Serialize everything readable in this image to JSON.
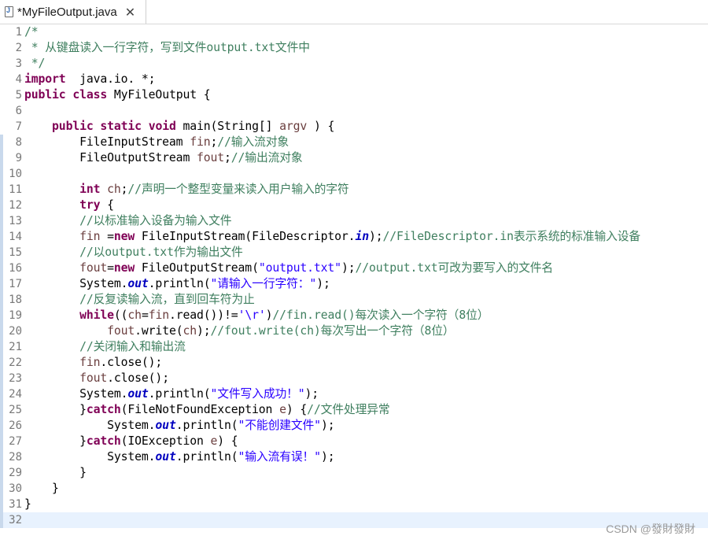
{
  "tab": {
    "title": "*MyFileOutput.java",
    "icon": "java-file-icon",
    "close": "✕"
  },
  "watermark": "CSDN @發財發財",
  "current_line": 32,
  "changed_lines": [
    8,
    9,
    10,
    11,
    12,
    13,
    14,
    15,
    16,
    17,
    18,
    19,
    20,
    21,
    22,
    23,
    24,
    25,
    26,
    27,
    28,
    29,
    30,
    31,
    32
  ],
  "lines": [
    {
      "n": "1",
      "t": [
        [
          "cm",
          "/*"
        ]
      ]
    },
    {
      "n": "2",
      "t": [
        [
          "cm",
          " * 从键盘读入一行字符，写到文件output.txt文件中"
        ]
      ]
    },
    {
      "n": "3",
      "t": [
        [
          "cm",
          " */"
        ]
      ]
    },
    {
      "n": "4",
      "t": [
        [
          "kw",
          "import"
        ],
        [
          "",
          "  java.io. *;"
        ]
      ]
    },
    {
      "n": "5",
      "t": [
        [
          "kw",
          "public"
        ],
        [
          "",
          " "
        ],
        [
          "kw",
          "class"
        ],
        [
          "",
          " MyFileOutput {"
        ]
      ]
    },
    {
      "n": "6",
      "t": []
    },
    {
      "n": "7",
      "t": [
        [
          "",
          "    "
        ],
        [
          "kw",
          "public"
        ],
        [
          "",
          " "
        ],
        [
          "kw",
          "static"
        ],
        [
          "",
          " "
        ],
        [
          "kw",
          "void"
        ],
        [
          "",
          " main(String[] "
        ],
        [
          "pm",
          "argv"
        ],
        [
          "",
          " ) {"
        ]
      ]
    },
    {
      "n": "8",
      "t": [
        [
          "",
          "        FileInputStream "
        ],
        [
          "pm",
          "fin"
        ],
        [
          "",
          ";"
        ],
        [
          "cm",
          "//输入流对象"
        ]
      ]
    },
    {
      "n": "9",
      "t": [
        [
          "",
          "        FileOutputStream "
        ],
        [
          "pm",
          "fout"
        ],
        [
          "",
          ";"
        ],
        [
          "cm",
          "//输出流对象"
        ]
      ]
    },
    {
      "n": "10",
      "t": []
    },
    {
      "n": "11",
      "t": [
        [
          "",
          "        "
        ],
        [
          "kw",
          "int"
        ],
        [
          "",
          " "
        ],
        [
          "pm",
          "ch"
        ],
        [
          "",
          ";"
        ],
        [
          "cm",
          "//声明一个整型变量来读入用户输入的字符"
        ]
      ]
    },
    {
      "n": "12",
      "t": [
        [
          "",
          "        "
        ],
        [
          "kw",
          "try"
        ],
        [
          "",
          " {"
        ]
      ]
    },
    {
      "n": "13",
      "t": [
        [
          "",
          "        "
        ],
        [
          "cm",
          "//以标准输入设备为输入文件"
        ]
      ]
    },
    {
      "n": "14",
      "t": [
        [
          "",
          "        "
        ],
        [
          "pm",
          "fin"
        ],
        [
          "",
          " ="
        ],
        [
          "kw",
          "new"
        ],
        [
          "",
          " FileInputStream(FileDescriptor."
        ],
        [
          "sf",
          "in"
        ],
        [
          "",
          ");"
        ],
        [
          "cm",
          "//FileDescriptor.in表示系统的标准输入设备"
        ]
      ]
    },
    {
      "n": "15",
      "t": [
        [
          "",
          "        "
        ],
        [
          "cm",
          "//以output.txt作为输出文件"
        ]
      ]
    },
    {
      "n": "16",
      "t": [
        [
          "",
          "        "
        ],
        [
          "pm",
          "fout"
        ],
        [
          "",
          "="
        ],
        [
          "kw",
          "new"
        ],
        [
          "",
          " FileOutputStream("
        ],
        [
          "st",
          "\"output.txt\""
        ],
        [
          "",
          ");"
        ],
        [
          "cm",
          "//output.txt可改为要写入的文件名"
        ]
      ]
    },
    {
      "n": "17",
      "t": [
        [
          "",
          "        System."
        ],
        [
          "sf",
          "out"
        ],
        [
          "",
          ".println("
        ],
        [
          "st",
          "\"请输入一行字符：\""
        ],
        [
          "",
          ");"
        ]
      ]
    },
    {
      "n": "18",
      "t": [
        [
          "",
          "        "
        ],
        [
          "cm",
          "//反复读输入流，直到回车符为止"
        ]
      ]
    },
    {
      "n": "19",
      "t": [
        [
          "",
          "        "
        ],
        [
          "kw",
          "while"
        ],
        [
          "",
          "(("
        ],
        [
          "pm",
          "ch"
        ],
        [
          "",
          "="
        ],
        [
          "pm",
          "fin"
        ],
        [
          "",
          ".read())!="
        ],
        [
          "st",
          "'\\r'"
        ],
        [
          "",
          ")"
        ],
        [
          "cm",
          "//fin.read()每次读入一个字符（8位）"
        ]
      ]
    },
    {
      "n": "20",
      "t": [
        [
          "",
          "            "
        ],
        [
          "pm",
          "fout"
        ],
        [
          "",
          ".write("
        ],
        [
          "pm",
          "ch"
        ],
        [
          "",
          ");"
        ],
        [
          "cm",
          "//fout.write(ch)每次写出一个字符（8位）"
        ]
      ]
    },
    {
      "n": "21",
      "t": [
        [
          "",
          "        "
        ],
        [
          "cm",
          "//关闭输入和输出流"
        ]
      ]
    },
    {
      "n": "22",
      "t": [
        [
          "",
          "        "
        ],
        [
          "pm",
          "fin"
        ],
        [
          "",
          ".close();"
        ]
      ]
    },
    {
      "n": "23",
      "t": [
        [
          "",
          "        "
        ],
        [
          "pm",
          "fout"
        ],
        [
          "",
          ".close();"
        ]
      ]
    },
    {
      "n": "24",
      "t": [
        [
          "",
          "        System."
        ],
        [
          "sf",
          "out"
        ],
        [
          "",
          ".println("
        ],
        [
          "st",
          "\"文件写入成功！\""
        ],
        [
          "",
          ");"
        ]
      ]
    },
    {
      "n": "25",
      "t": [
        [
          "",
          "        }"
        ],
        [
          "kw",
          "catch"
        ],
        [
          "",
          "(FileNotFoundException "
        ],
        [
          "pm",
          "e"
        ],
        [
          "",
          ") {"
        ],
        [
          "cm",
          "//文件处理异常"
        ]
      ]
    },
    {
      "n": "26",
      "t": [
        [
          "",
          "            System."
        ],
        [
          "sf",
          "out"
        ],
        [
          "",
          ".println("
        ],
        [
          "st",
          "\"不能创建文件\""
        ],
        [
          "",
          ");"
        ]
      ]
    },
    {
      "n": "27",
      "t": [
        [
          "",
          "        }"
        ],
        [
          "kw",
          "catch"
        ],
        [
          "",
          "(IOException "
        ],
        [
          "pm",
          "e"
        ],
        [
          "",
          ") {"
        ]
      ]
    },
    {
      "n": "28",
      "t": [
        [
          "",
          "            System."
        ],
        [
          "sf",
          "out"
        ],
        [
          "",
          ".println("
        ],
        [
          "st",
          "\"输入流有误！\""
        ],
        [
          "",
          ");"
        ]
      ]
    },
    {
      "n": "29",
      "t": [
        [
          "",
          "        }"
        ]
      ]
    },
    {
      "n": "30",
      "t": [
        [
          "",
          "    }"
        ]
      ]
    },
    {
      "n": "31",
      "t": [
        [
          "",
          "}"
        ]
      ]
    },
    {
      "n": "32",
      "t": []
    }
  ]
}
